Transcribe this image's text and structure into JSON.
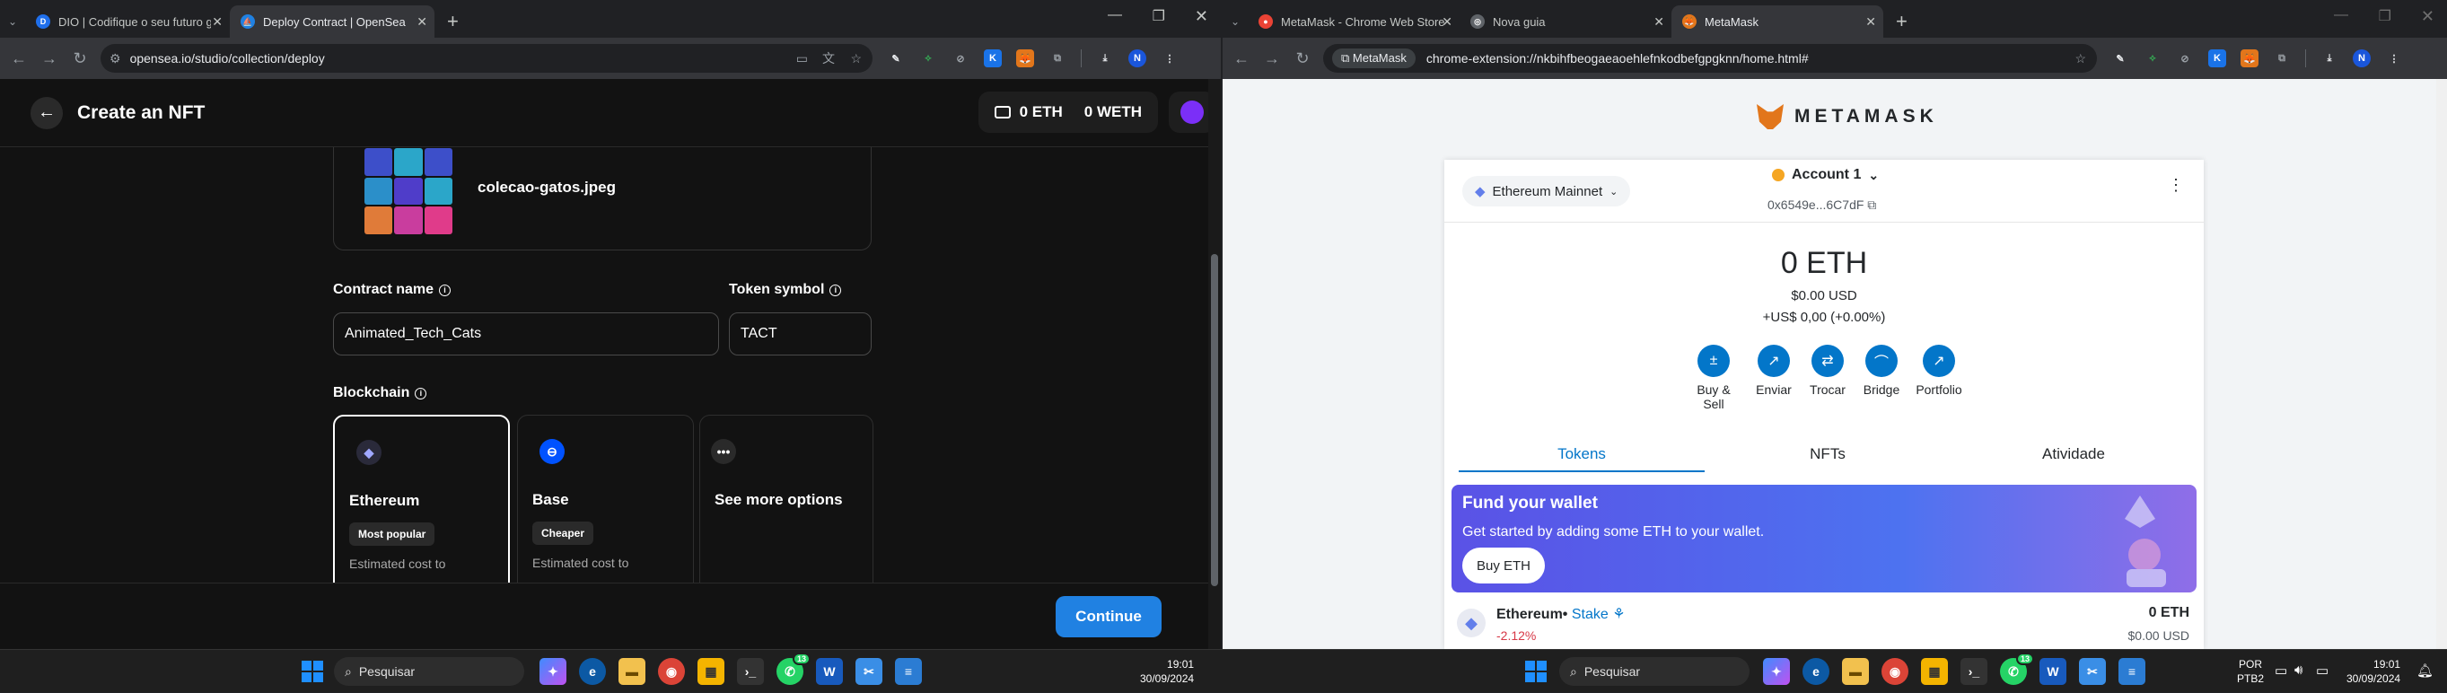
{
  "left_window": {
    "tabs": [
      {
        "title": "DIO | Codifique o seu futuro gl",
        "fav_color": "#1f6feb"
      },
      {
        "title": "Deploy Contract | OpenSea",
        "fav_color": "#2081e2"
      }
    ],
    "url": "opensea.io/studio/collection/deploy",
    "page_title": "Create an NFT",
    "balance_eth": "0 ETH",
    "balance_weth": "0 WETH",
    "file_name": "colecao-gatos.jpeg",
    "contract_name_label": "Contract name",
    "contract_name_value": "Animated_Tech_Cats",
    "token_symbol_label": "Token symbol",
    "token_symbol_value": "TACT",
    "blockchain_label": "Blockchain",
    "chains": [
      {
        "name": "Ethereum",
        "badge": "Most popular",
        "desc": "Estimated cost to"
      },
      {
        "name": "Base",
        "badge": "Cheaper",
        "desc": "Estimated cost to"
      },
      {
        "name": "See more options"
      }
    ],
    "continue_label": "Continue"
  },
  "right_window": {
    "tabs": [
      {
        "title": "MetaMask - Chrome Web Store"
      },
      {
        "title": "Nova guia"
      },
      {
        "title": "MetaMask"
      }
    ],
    "url_chip": "MetaMask",
    "url": "chrome-extension://nkbihfbeogaeaoehlefnkodbefgpgknn/home.html#",
    "brand": "METAMASK",
    "network": "Ethereum Mainnet",
    "account": "Account 1",
    "address": "0x6549e...6C7dF",
    "balance": "0 ETH",
    "usd": "$0.00 USD",
    "change": "+US$ 0,00 (+0.00%)",
    "actions": [
      "Buy & Sell",
      "Enviar",
      "Trocar",
      "Bridge",
      "Portfolio"
    ],
    "tabs_main": [
      "Tokens",
      "NFTs",
      "Atividade"
    ],
    "fund_title": "Fund your wallet",
    "fund_text": "Get started by adding some ETH to your wallet.",
    "buy_eth": "Buy ETH",
    "token": {
      "name": "Ethereum",
      "stake": "Stake",
      "pct": "-2.12%",
      "balance": "0 ETH",
      "usd": "$0.00 USD"
    }
  },
  "taskbar": {
    "search": "Pesquisar",
    "time": "19:01",
    "date": "30/09/2024",
    "lang_1": "POR",
    "lang_2": "PTB2",
    "whatsapp_badge": "13"
  }
}
